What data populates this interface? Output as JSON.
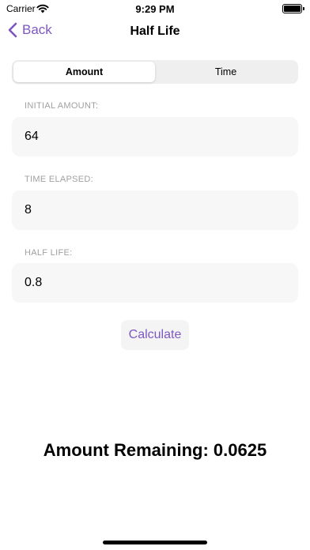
{
  "status_bar": {
    "carrier": "Carrier",
    "time": "9:29 PM"
  },
  "nav": {
    "back_label": "Back",
    "title": "Half Life"
  },
  "segments": [
    {
      "label": "Amount",
      "selected": true
    },
    {
      "label": "Time",
      "selected": false
    }
  ],
  "fields": {
    "initial_amount": {
      "label": "INITIAL AMOUNT:",
      "value": "64"
    },
    "time_elapsed": {
      "label": "TIME ELAPSED:",
      "value": "8"
    },
    "half_life": {
      "label": "HALF LIFE:",
      "value": "0.8"
    }
  },
  "calculate_label": "Calculate",
  "result_text": "Amount Remaining: 0.0625",
  "colors": {
    "accent": "#7E57C2",
    "field_bg": "#F7F7F8",
    "label": "#A0A0A4"
  }
}
